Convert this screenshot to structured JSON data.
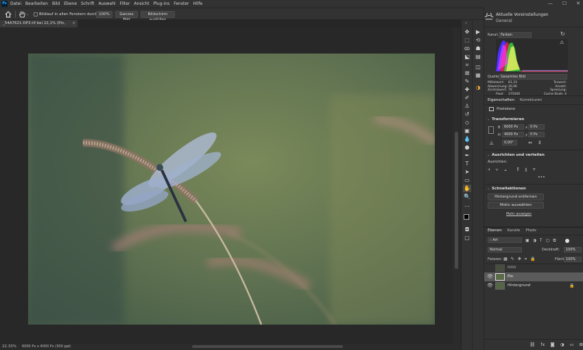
{
  "menubar": {
    "logo": "Ps",
    "items": [
      "Datei",
      "Bearbeiten",
      "Bild",
      "Ebene",
      "Schrift",
      "Auswahl",
      "Filter",
      "Ansicht",
      "Plug-ins",
      "Fenster",
      "Hilfe"
    ],
    "window_controls": [
      "—",
      "☐",
      "✕"
    ]
  },
  "options_bar": {
    "scroll_all_label": "Bildlauf in allen Fenstern durchführen",
    "zoom_100": "100%",
    "fit_screen": "Ganzes Bild",
    "fill_screen": "Bildschirm ausfüllen"
  },
  "document": {
    "tab_title": "_54A7621-DP3.tif bei 22,1% (Pin, RGB/16) *",
    "close": "×"
  },
  "status": {
    "zoom": "22.33%",
    "doc_info": "6000 Px x 4000 Px (300 ppi)",
    "arrow": "›"
  },
  "histogram": {
    "header_title": "Aktuelle Voreinstellungen",
    "header_subtitle": "General",
    "channel_label": "Kanal:",
    "channel_value": "Farben",
    "source_label": "Quelle:",
    "source_value": "Gesamtes Bild",
    "stats_left": [
      {
        "label": "Mittelwert:",
        "value": "81,33"
      },
      {
        "label": "Abweichung:",
        "value": "26,96"
      },
      {
        "label": "Zentralwert:",
        "value": "79"
      },
      {
        "label": "Pixel:",
        "value": "375000"
      }
    ],
    "stats_right": [
      {
        "label": "Tonwert:",
        "value": ""
      },
      {
        "label": "Anzahl:",
        "value": ""
      },
      {
        "label": "Spreizung:",
        "value": ""
      },
      {
        "label": "Cache-Stufe:",
        "value": "4"
      }
    ]
  },
  "properties": {
    "tabs": [
      "Eigenschaften",
      "Korrekturen"
    ],
    "pixel_layer": "Pixelebene",
    "transform_title": "Transformieren",
    "w_label": "B",
    "w_value": "6000 Px",
    "x_label": "x",
    "x_value": "0 Px",
    "h_label": "H",
    "h_value": "4000 Px",
    "y_label": "y",
    "y_value": "0 Px",
    "angle_value": "0,00°",
    "align_title": "Ausrichten und verteilen",
    "align_label": "Ausrichten:",
    "quick_title": "Schnellaktionen",
    "remove_bg": "Hintergrund entfernen",
    "select_subject": "Motiv auswählen",
    "more": "Mehr anzeigen"
  },
  "layers": {
    "tabs": [
      "Ebenen",
      "Kanäle",
      "Pfade"
    ],
    "kind_filter": "Art",
    "blend_mode": "Normal",
    "opacity_label": "Deckkraft:",
    "opacity_value": "100%",
    "lock_label": "Fixieren:",
    "fill_label": "Fläche:",
    "fill_value": "100%",
    "items": [
      {
        "name": "RAW",
        "visible": false,
        "selected": false
      },
      {
        "name": "Pin",
        "visible": true,
        "selected": true
      },
      {
        "name": "Hintergrund",
        "visible": true,
        "selected": false,
        "locked": true
      }
    ]
  },
  "colors": {
    "bg": "#282828",
    "panel": "#323232",
    "accent": "#31a8ff"
  }
}
